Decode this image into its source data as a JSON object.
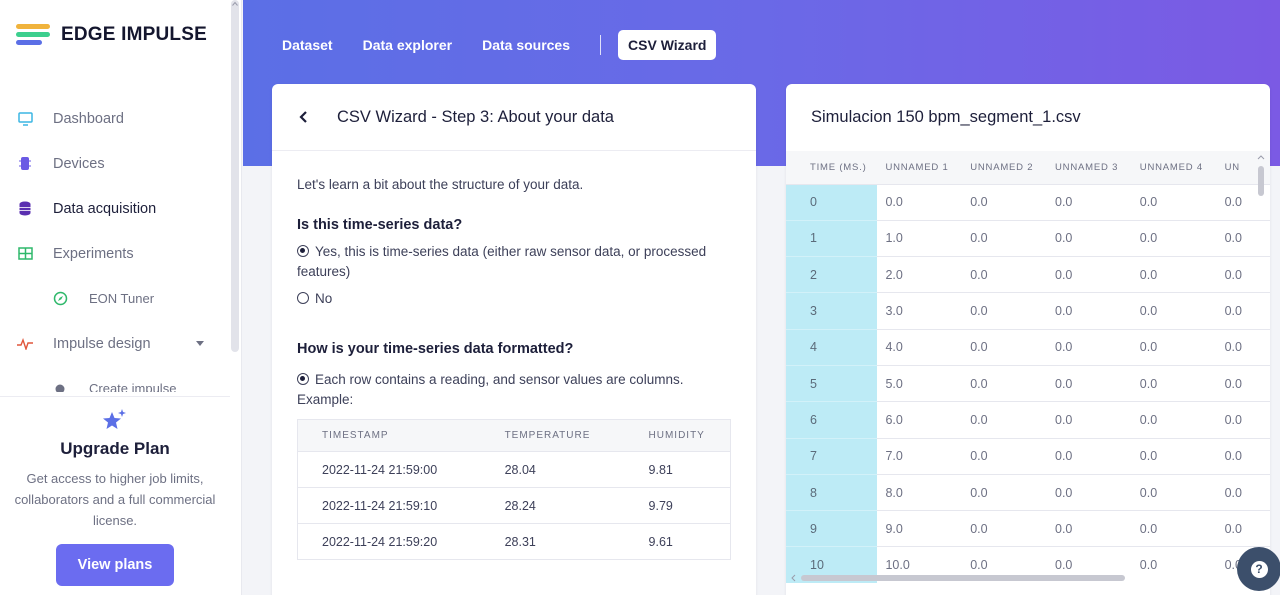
{
  "brand": {
    "name": "EDGE IMPULSE",
    "colors": [
      "#f0b33c",
      "#3ccf8e",
      "#5b6fe6"
    ]
  },
  "sidebar": {
    "items": [
      {
        "label": "Dashboard",
        "icon": "monitor-icon",
        "color": "#3cb6e3"
      },
      {
        "label": "Devices",
        "icon": "chip-icon",
        "color": "#6a5ae4"
      },
      {
        "label": "Data acquisition",
        "icon": "database-icon",
        "color": "#5a2fb0"
      },
      {
        "label": "Experiments",
        "icon": "table-icon",
        "color": "#2fb86b"
      },
      {
        "label": "EON Tuner",
        "icon": "compass-icon",
        "color": "#2fb86b"
      },
      {
        "label": "Impulse design",
        "icon": "pulse-icon",
        "color": "#e0573c"
      },
      {
        "label": "Create impulse",
        "icon": "dot-icon",
        "color": "#6d7083"
      }
    ],
    "upgrade": {
      "title": "Upgrade Plan",
      "text": "Get access to higher job limits, collaborators and a full commercial license.",
      "button": "View plans"
    }
  },
  "tabs": {
    "dataset": "Dataset",
    "explorer": "Data explorer",
    "sources": "Data sources",
    "wizard": "CSV Wizard"
  },
  "wizard": {
    "title": "CSV Wizard - Step 3: About your data",
    "intro": "Let's learn a bit about the structure of your data.",
    "q1": "Is this time-series data?",
    "q1_yes": "Yes, this is time-series data (either raw sensor data, or processed features)",
    "q1_no": "No",
    "q2": "How is your time-series data formatted?",
    "q2_opt": "Each row contains a reading, and sensor values are columns. Example:",
    "example": {
      "headers": [
        "TIMESTAMP",
        "TEMPERATURE",
        "HUMIDITY"
      ],
      "rows": [
        [
          "2022-11-24 21:59:00",
          "28.04",
          "9.81"
        ],
        [
          "2022-11-24 21:59:10",
          "28.24",
          "9.79"
        ],
        [
          "2022-11-24 21:59:20",
          "28.31",
          "9.61"
        ]
      ]
    }
  },
  "preview": {
    "title": "Simulacion 150 bpm_segment_1.csv",
    "headers": [
      "TIME (MS.)",
      "UNNAMED 1",
      "UNNAMED 2",
      "UNNAMED 3",
      "UNNAMED 4",
      "UN"
    ],
    "rows": [
      [
        "0",
        "0.0",
        "0.0",
        "0.0",
        "0.0",
        "0.0"
      ],
      [
        "1",
        "1.0",
        "0.0",
        "0.0",
        "0.0",
        "0.0"
      ],
      [
        "2",
        "2.0",
        "0.0",
        "0.0",
        "0.0",
        "0.0"
      ],
      [
        "3",
        "3.0",
        "0.0",
        "0.0",
        "0.0",
        "0.0"
      ],
      [
        "4",
        "4.0",
        "0.0",
        "0.0",
        "0.0",
        "0.0"
      ],
      [
        "5",
        "5.0",
        "0.0",
        "0.0",
        "0.0",
        "0.0"
      ],
      [
        "6",
        "6.0",
        "0.0",
        "0.0",
        "0.0",
        "0.0"
      ],
      [
        "7",
        "7.0",
        "0.0",
        "0.0",
        "0.0",
        "0.0"
      ],
      [
        "8",
        "8.0",
        "0.0",
        "0.0",
        "0.0",
        "0.0"
      ],
      [
        "9",
        "9.0",
        "0.0",
        "0.0",
        "0.0",
        "0.0"
      ],
      [
        "10",
        "10.0",
        "0.0",
        "0.0",
        "0.0",
        "0.0"
      ]
    ]
  },
  "help": "?"
}
